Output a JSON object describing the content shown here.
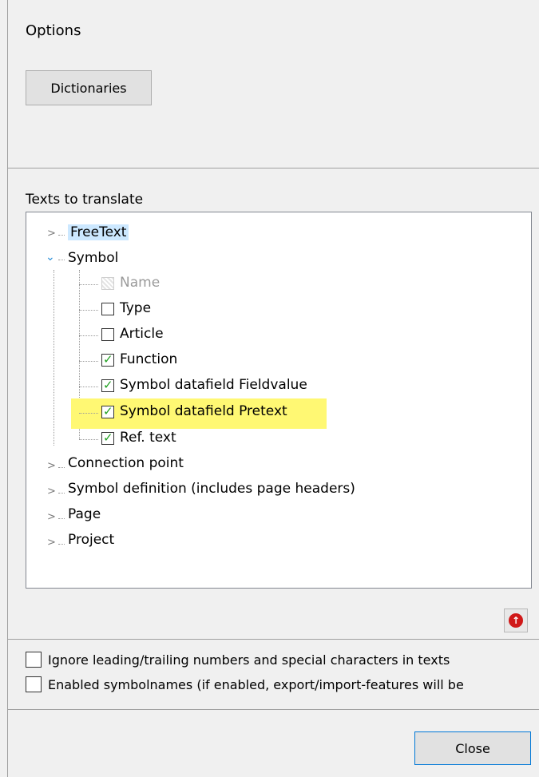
{
  "window": {
    "title": "Options"
  },
  "toolbar": {
    "dictionaries_label": "Dictionaries"
  },
  "texts_section": {
    "label": "Texts to translate"
  },
  "tree": {
    "freetext": "FreeText",
    "symbol": "Symbol",
    "symbol_children": {
      "name": "Name",
      "type": "Type",
      "article": "Article",
      "function": "Function",
      "fieldvalue": "Symbol datafield Fieldvalue",
      "pretext": "Symbol datafield Pretext",
      "ref_text": "Ref. text"
    },
    "connection_point": "Connection point",
    "symbol_definition": "Symbol definition (includes page headers)",
    "page": "Page",
    "project": "Project"
  },
  "options": {
    "ignore_numbers": "Ignore leading/trailing numbers and special characters in texts",
    "enabled_symbolnames": "Enabled symbolnames (if enabled, export/import-features will be"
  },
  "footer": {
    "close_label": "Close"
  },
  "colors": {
    "highlight": "#fff873",
    "selection": "#cce8ff",
    "check": "#20a020",
    "up_icon": "#d01818"
  },
  "icons": {
    "expand": "chevron-right-icon",
    "collapse": "chevron-down-icon",
    "move_up": "arrow-up-icon"
  }
}
